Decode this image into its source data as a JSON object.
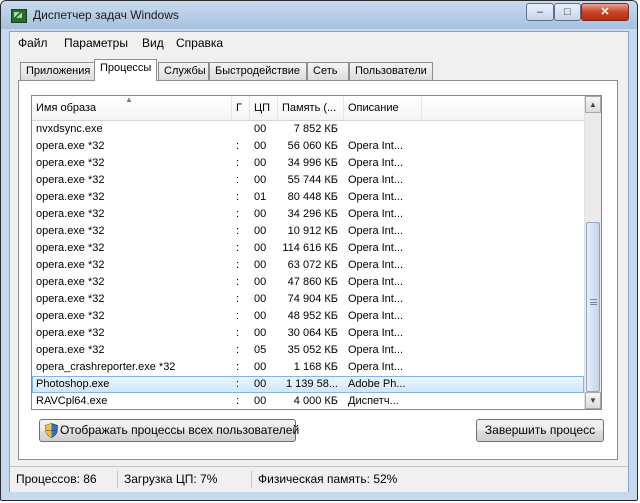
{
  "window": {
    "title": "Диспетчер задач Windows",
    "minimize": "–",
    "maximize": "□",
    "close": "✕"
  },
  "menu": [
    "Файл",
    "Параметры",
    "Вид",
    "Справка"
  ],
  "tabs": [
    "Приложения",
    "Процессы",
    "Службы",
    "Быстродействие",
    "Сеть",
    "Пользователи"
  ],
  "active_tab": "Процессы",
  "table": {
    "columns": [
      "Имя образа",
      "Г",
      "ЦП",
      "Память (...",
      "Описание"
    ],
    "rows": [
      [
        "nvxdsync.exe",
        "",
        "00",
        "7 852 КБ",
        ""
      ],
      [
        "opera.exe *32",
        ":",
        "00",
        "56 060 КБ",
        "Opera Int..."
      ],
      [
        "opera.exe *32",
        ":",
        "00",
        "34 996 КБ",
        "Opera Int..."
      ],
      [
        "opera.exe *32",
        ":",
        "00",
        "55 744 КБ",
        "Opera Int..."
      ],
      [
        "opera.exe *32",
        ":",
        "01",
        "80 448 КБ",
        "Opera Int..."
      ],
      [
        "opera.exe *32",
        ":",
        "00",
        "34 296 КБ",
        "Opera Int..."
      ],
      [
        "opera.exe *32",
        ":",
        "00",
        "10 912 КБ",
        "Opera Int..."
      ],
      [
        "opera.exe *32",
        ":",
        "00",
        "114 616 КБ",
        "Opera Int..."
      ],
      [
        "opera.exe *32",
        ":",
        "00",
        "63 072 КБ",
        "Opera Int..."
      ],
      [
        "opera.exe *32",
        ":",
        "00",
        "47 860 КБ",
        "Opera Int..."
      ],
      [
        "opera.exe *32",
        ":",
        "00",
        "74 904 КБ",
        "Opera Int..."
      ],
      [
        "opera.exe *32",
        ":",
        "00",
        "48 952 КБ",
        "Opera Int..."
      ],
      [
        "opera.exe *32",
        ":",
        "00",
        "30 064 КБ",
        "Opera Int..."
      ],
      [
        "opera.exe *32",
        ":",
        "05",
        "35 052 КБ",
        "Opera Int..."
      ],
      [
        "opera_crashreporter.exe *32",
        ":",
        "00",
        "1 168 КБ",
        "Opera Int..."
      ],
      [
        "Photoshop.exe",
        ":",
        "00",
        "1 139 58...",
        "Adobe Ph..."
      ],
      [
        "RAVCpl64.exe",
        ":",
        "00",
        "4 000 КБ",
        "Диспетч..."
      ]
    ],
    "selected_row": 15
  },
  "buttons": {
    "show_all": "Отображать процессы всех пользователей",
    "end_process": "Завершить процесс"
  },
  "status": {
    "processes": "Процессов: 86",
    "cpu": "Загрузка ЦП: 7%",
    "memory": "Физическая память: 52%"
  },
  "colors": {
    "selection": "#cfe6fb",
    "title_gradient": "#b9d1ea"
  }
}
